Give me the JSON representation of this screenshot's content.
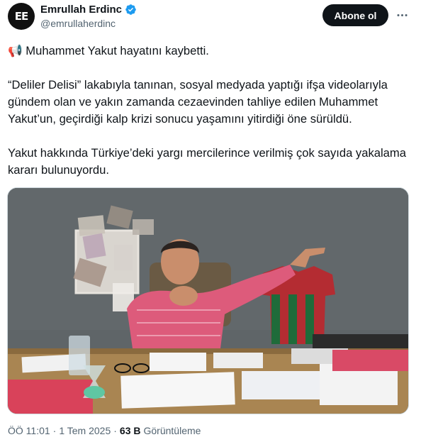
{
  "author": {
    "display_name": "Emrullah Erdinc",
    "handle": "@emrullaherdinc",
    "avatar_letters": "EE",
    "verified": true
  },
  "follow_label": "Abone ol",
  "more_icon": "more-horizontal-icon",
  "tweet": {
    "line1_emoji": "📢",
    "line1": "Muhammet Yakut hayatını kaybetti.",
    "para2": "“Deliler Delisi” lakabıyla tanınan, sosyal medyada yaptığı ifşa videolarıyla gündem olan ve yakın zamanda cezaevinden tahliye edilen Muhammet Yakut’un, geçirdiği kalp krizi sonucu yaşamını yitirdiği öne sürüldü.",
    "para3": "Yakut hakkında Türkiye’deki yargı mercilerince verilmiş çok sayıda yakalama kararı bulunuyordu."
  },
  "meta": {
    "time": "ÖÖ 11:01",
    "separator": "·",
    "date": "1 Tem 2025",
    "views_count": "63 B",
    "views_label": "Görüntüleme"
  },
  "colors": {
    "text": "#0f1419",
    "secondary": "#536471",
    "verified_blue": "#1d9bf0",
    "follow_bg": "#0f1419"
  }
}
